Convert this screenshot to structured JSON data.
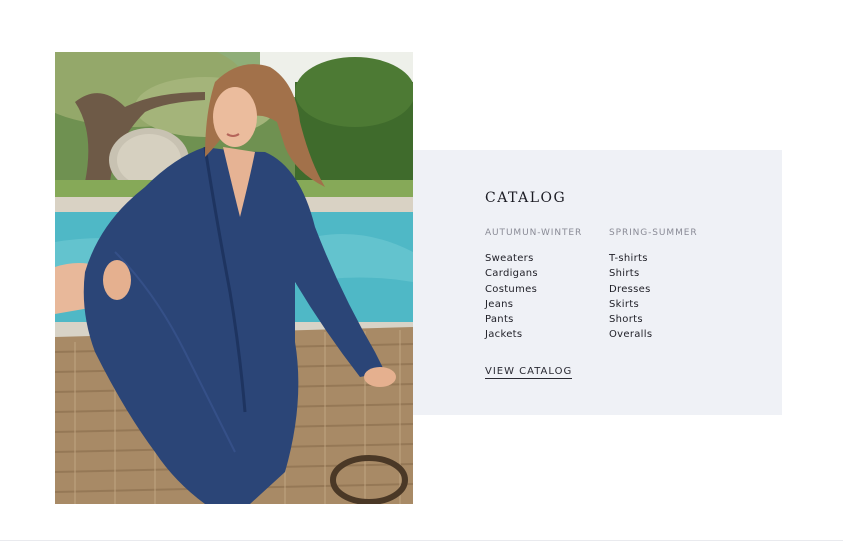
{
  "photo": {
    "alt": ""
  },
  "catalog": {
    "title": "CATALOG",
    "columns": [
      {
        "heading": "AUTUMUN-WINTER",
        "items": [
          "Sweaters",
          "Cardigans",
          "Costumes",
          "Jeans",
          "Pants",
          "Jackets"
        ]
      },
      {
        "heading": "SPRING-SUMMER",
        "items": [
          "T-shirts",
          "Shirts",
          "Dresses",
          "Skirts",
          "Shorts",
          "Overalls"
        ]
      }
    ],
    "view_label": "VIEW CATALOG"
  },
  "colors": {
    "panel_background": "#eff1f6",
    "dress_blue": "#2b4577",
    "pool_blue": "#4fb8c6"
  }
}
